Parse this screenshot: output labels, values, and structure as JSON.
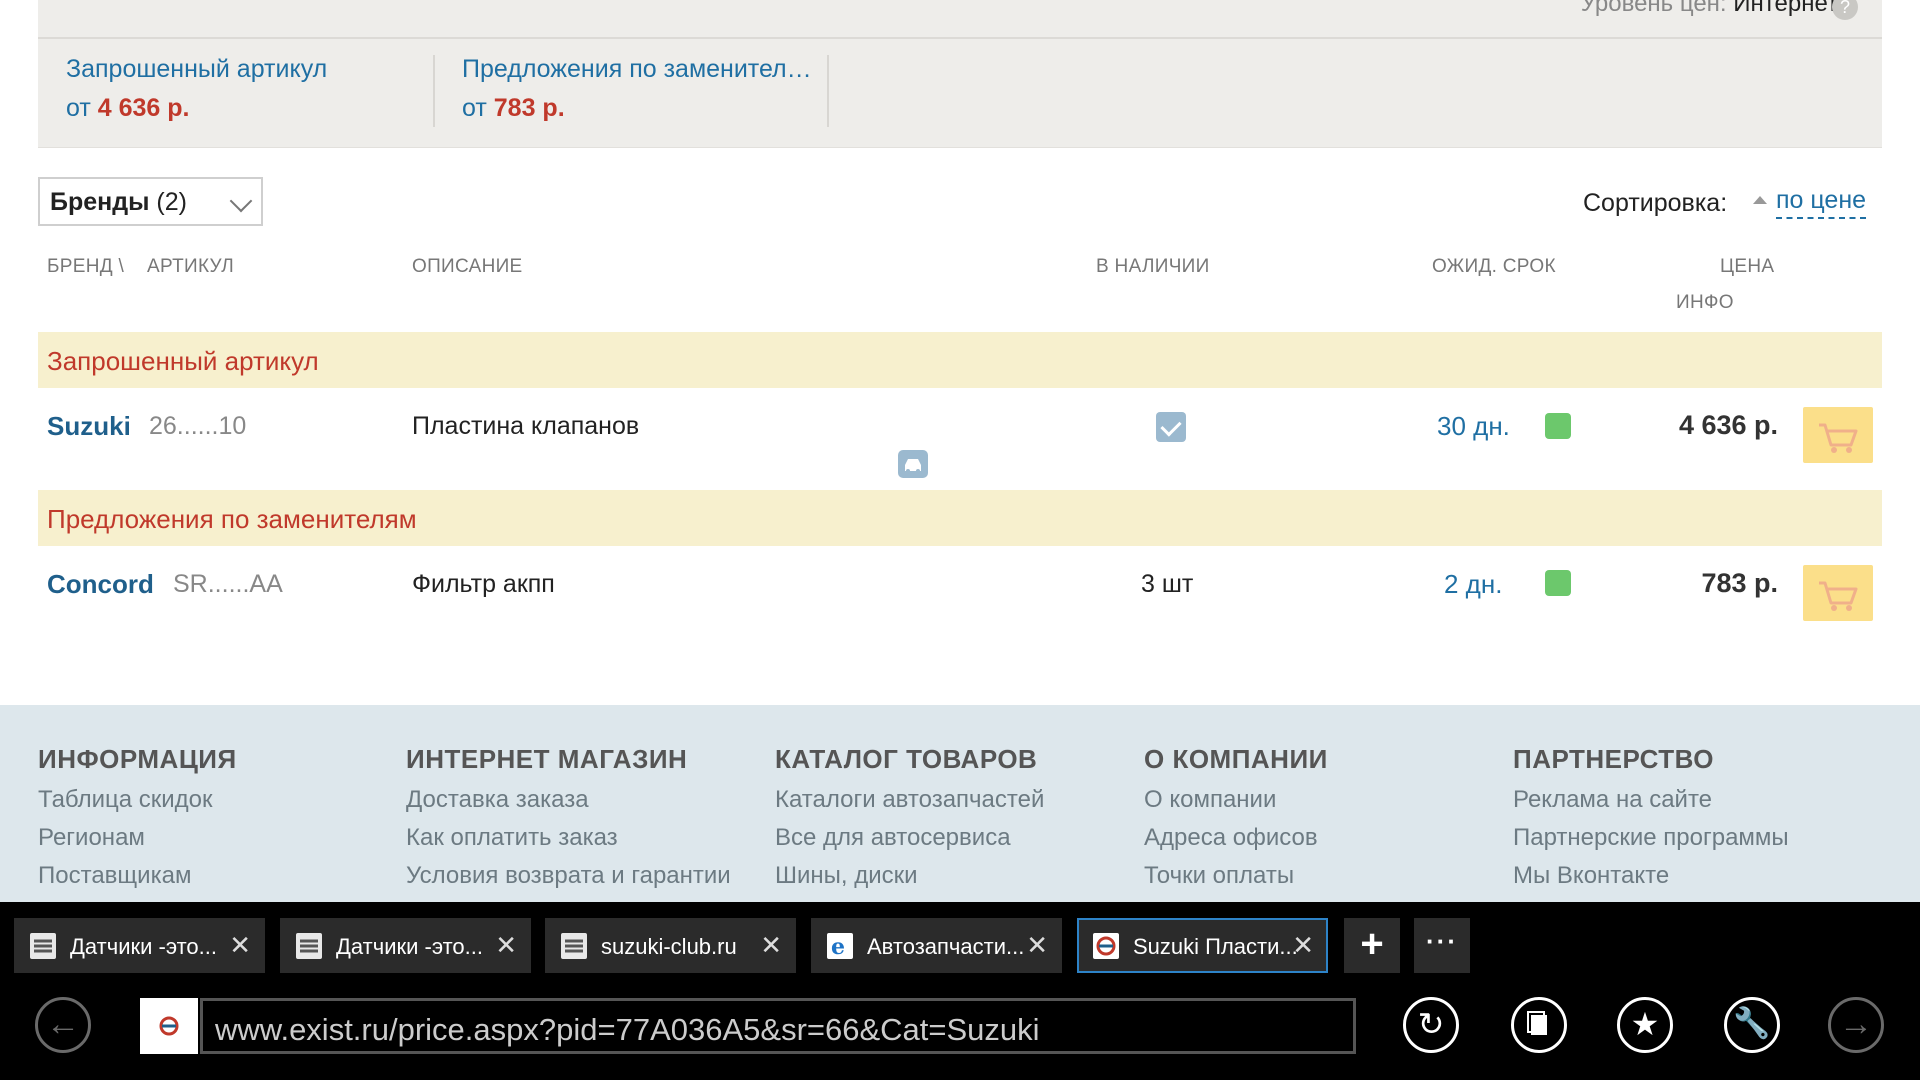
{
  "top": {
    "price_level_label": "Уровень цен:",
    "price_level_value": "Интернет",
    "help_icon": "?",
    "summaries": [
      {
        "title": "Запрошенный артикул",
        "prefix": "от",
        "price": "4 636 р."
      },
      {
        "title": "Предложения по заменителям",
        "prefix": "от",
        "price": "783 р."
      }
    ]
  },
  "filters": {
    "brands_label": "Бренды",
    "brands_count": "(2)",
    "sort_label": "Сортировка:",
    "sort_value": "по цене"
  },
  "columns": {
    "brand": "БРЕНД \\",
    "article": "АРТИКУЛ",
    "description": "ОПИСАНИЕ",
    "availability": "В НАЛИЧИИ",
    "term": "ОЖИД. СРОК",
    "price": "ЦЕНА",
    "info": "ИНФО"
  },
  "sections": [
    {
      "title": "Запрошенный артикул",
      "rows": [
        {
          "brand": "Suzuki",
          "article": "26......10",
          "description": "Пластина клапанов",
          "availability": "",
          "availability_icon": "check-icon",
          "term": "30 дн.",
          "status_color": "#6cc86c",
          "price": "4 636 р.",
          "extra_icon": "car-icon"
        }
      ]
    },
    {
      "title": "Предложения по заменителям",
      "rows": [
        {
          "brand": "Concord",
          "article": "SR......AA",
          "description": "Фильтр акпп",
          "availability": "3 шт",
          "term": "2 дн.",
          "status_color": "#6cc86c",
          "price": "783 р."
        }
      ]
    }
  ],
  "footer": {
    "columns": [
      {
        "title": "ИНФОРМАЦИЯ",
        "links": [
          "Таблица скидок",
          "Регионам",
          "Поставщикам"
        ]
      },
      {
        "title": "ИНТЕРНЕТ МАГАЗИН",
        "links": [
          "Доставка заказа",
          "Как оплатить заказ",
          "Условия возврата и гарантии"
        ]
      },
      {
        "title": "КАТАЛОГ ТОВАРОВ",
        "links": [
          "Каталоги автозапчастей",
          "Все для автосервиса",
          "Шины, диски"
        ]
      },
      {
        "title": "О КОМПАНИИ",
        "links": [
          "О компании",
          "Адреса офисов",
          "Точки оплаты"
        ]
      },
      {
        "title": "ПАРТНЕРСТВО",
        "links": [
          "Реклама на сайте",
          "Партнерские программы",
          "Мы Вконтакте"
        ]
      }
    ]
  },
  "browser": {
    "tabs": [
      {
        "title": "Датчики -это...",
        "favicon": "forum-icon",
        "active": false
      },
      {
        "title": "Датчики -это...",
        "favicon": "forum-icon",
        "active": false
      },
      {
        "title": "suzuki-club.ru",
        "favicon": "forum-icon",
        "active": false
      },
      {
        "title": "Автозапчасти...",
        "favicon": "ie-icon",
        "active": false
      },
      {
        "title": "Suzuki Пласти...",
        "favicon": "exist-icon",
        "active": true
      }
    ],
    "new_tab": "+",
    "more": "···",
    "close_glyph": "✕",
    "url": "www.exist.ru/price.aspx?pid=77A036A5&sr=66&Cat=Suzuki",
    "colors": {
      "accent": "#2d83c8",
      "brand_red": "#c0392b",
      "link_blue": "#1f6fa3"
    }
  }
}
